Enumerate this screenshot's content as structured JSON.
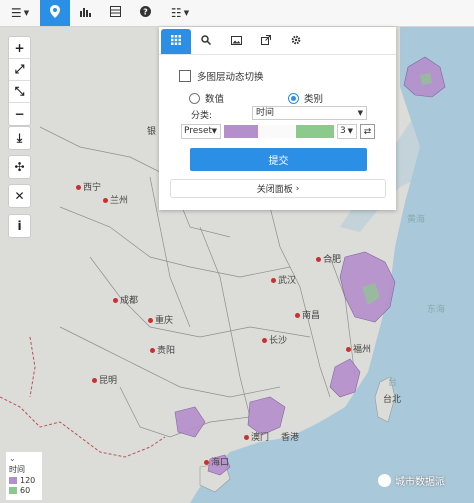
{
  "toolbar": {
    "items": [
      "menu-icon",
      "location-icon",
      "bar-chart-icon",
      "table-icon",
      "help-icon",
      "list-icon"
    ]
  },
  "side_tools": {
    "group1": [
      "+",
      "⤢",
      "⤡",
      "−"
    ],
    "group2": [
      "⤓"
    ],
    "group3": [
      "✣"
    ],
    "group4": [
      "✕"
    ],
    "group5": [
      "i"
    ]
  },
  "panel": {
    "tabs": [
      "grid-icon",
      "search-icon",
      "image-icon",
      "share-icon",
      "gear-icon"
    ],
    "multi_layer_label": "多图层动态切换",
    "radio_numeric": "数值",
    "radio_category": "类别",
    "classify_label": "分类:",
    "classify_value": "时间",
    "preset_value": "Preset",
    "class_count": "3",
    "submit_label": "提交",
    "close_label": "关闭面板"
  },
  "colors": {
    "accent": "#2b8fe5",
    "ramp_start": "#b58fcc",
    "ramp_end": "#8cc98c"
  },
  "cities": {
    "xining": "西宁",
    "lanzhou": "兰州",
    "chengdu": "成都",
    "chongqing": "重庆",
    "guiyang": "贵阳",
    "kunming": "昆明",
    "wuhan": "武汉",
    "hefei": "合肥",
    "nanchang": "南昌",
    "changsha": "长沙",
    "fuzhou": "福州",
    "macau": "澳门",
    "hongkong": "香港",
    "haikou": "海口",
    "taibei": "台北",
    "yin": "银"
  },
  "regions": {
    "huanghai": "黄海",
    "donghai": "东海",
    "tai": "台"
  },
  "legend": {
    "title": "时间",
    "items": [
      {
        "label": "120"
      },
      {
        "label": "60"
      }
    ]
  },
  "watermark": "城市数据派"
}
